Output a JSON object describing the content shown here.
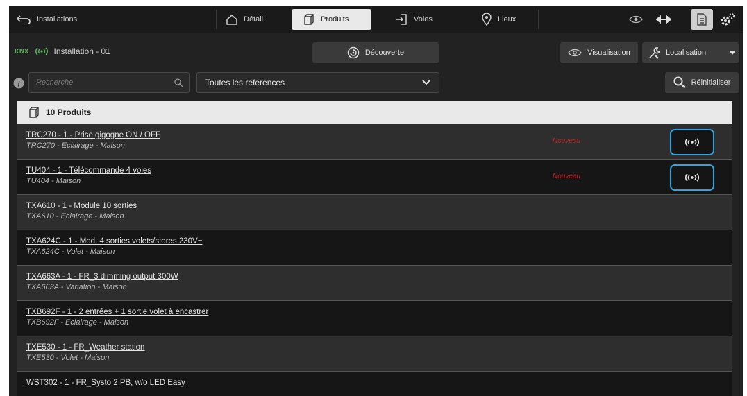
{
  "colors": {
    "accent": "#2fa4e0",
    "badge": "#c42020",
    "active_tab": "#e9e9e9"
  },
  "topbar": {
    "back_label": "Installations",
    "tabs": [
      {
        "label": "Détail",
        "icon": "home-icon"
      },
      {
        "label": "Produits",
        "icon": "box-icon",
        "active": true
      },
      {
        "label": "Voies",
        "icon": "exit-icon"
      },
      {
        "label": "Lieux",
        "icon": "location-pin-icon"
      }
    ],
    "right_icons": [
      "eye-icon",
      "swap-arrows-icon",
      "document-icon",
      "settings-gears-icon"
    ]
  },
  "header": {
    "knx_label": "KNX",
    "installation_name": "Installation - 01",
    "discovery_label": "Découverte",
    "visualisation_label": "Visualisation",
    "localisation_label": "Localisation"
  },
  "filters": {
    "search_placeholder": "Recherche",
    "select_value": "Toutes les références",
    "reset_label": "Réinitialiser"
  },
  "products": {
    "count_label": "10 Produits",
    "items": [
      {
        "title": "TRC270 - 1 - Prise gigogne ON / OFF",
        "subtitle": "TRC270 - Eclairage - Maison",
        "badge": "Nouveau",
        "rf": true
      },
      {
        "title": "TU404 - 1 - Télécommande 4 voies",
        "subtitle": "TU404 - Maison",
        "badge": "Nouveau",
        "rf": true
      },
      {
        "title": "TXA610 - 1 - Module 10 sorties",
        "subtitle": "TXA610 - Eclairage - Maison"
      },
      {
        "title": "TXA624C - 1 - Mod. 4 sorties volets/stores 230V~",
        "subtitle": "TXA624C - Volet - Maison"
      },
      {
        "title": "TXA663A - 1 - FR_3 dimming output 300W",
        "subtitle": "TXA663A - Variation - Maison"
      },
      {
        "title": "TXB692F - 1 - 2 entrées + 1 sortie volet à encastrer",
        "subtitle": "TXB692F - Eclairage - Maison"
      },
      {
        "title": "TXE530 - 1 - FR_Weather station",
        "subtitle": "TXE530 - Volet - Maison"
      },
      {
        "title": "WST302 - 1 - FR_Systo 2 PB, w/o LED Easy",
        "subtitle": ""
      }
    ]
  }
}
